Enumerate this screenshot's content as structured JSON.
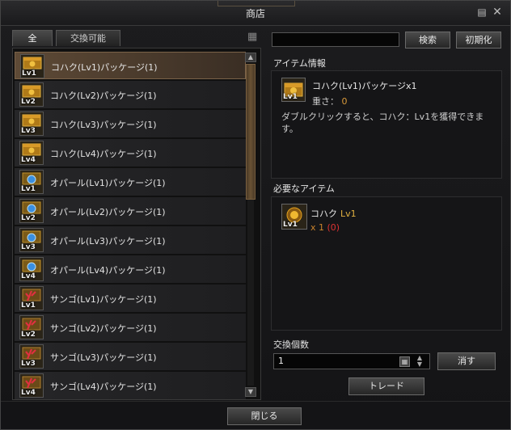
{
  "window": {
    "title": "商店",
    "help_icon": "help-menu-icon",
    "close_icon": "close-icon"
  },
  "tabs": [
    {
      "label": "全",
      "active": true
    },
    {
      "label": "交換可能",
      "active": false
    }
  ],
  "items": [
    {
      "name": "コハク(Lv1)パッケージ(1)",
      "level": "Lv1",
      "type": "amber",
      "selected": true
    },
    {
      "name": "コハク(Lv2)パッケージ(1)",
      "level": "Lv2",
      "type": "amber"
    },
    {
      "name": "コハク(Lv3)パッケージ(1)",
      "level": "Lv3",
      "type": "amber"
    },
    {
      "name": "コハク(Lv4)パッケージ(1)",
      "level": "Lv4",
      "type": "amber"
    },
    {
      "name": "オパール(Lv1)パッケージ(1)",
      "level": "Lv1",
      "type": "opal"
    },
    {
      "name": "オパール(Lv2)パッケージ(1)",
      "level": "Lv2",
      "type": "opal"
    },
    {
      "name": "オパール(Lv3)パッケージ(1)",
      "level": "Lv3",
      "type": "opal"
    },
    {
      "name": "オパール(Lv4)パッケージ(1)",
      "level": "Lv4",
      "type": "opal"
    },
    {
      "name": "サンゴ(Lv1)パッケージ(1)",
      "level": "Lv1",
      "type": "coral"
    },
    {
      "name": "サンゴ(Lv2)パッケージ(1)",
      "level": "Lv2",
      "type": "coral"
    },
    {
      "name": "サンゴ(Lv3)パッケージ(1)",
      "level": "Lv3",
      "type": "coral"
    },
    {
      "name": "サンゴ(Lv4)パッケージ(1)",
      "level": "Lv4",
      "type": "coral"
    }
  ],
  "search": {
    "value": "",
    "button": "検索",
    "reset_button": "初期化"
  },
  "info": {
    "heading": "アイテム情報",
    "name": "コハク(Lv1)パッケージx1",
    "weight_label": "重さ：",
    "weight_value": "0",
    "description": "ダブルクリックすると、コハク：Lv1を獲得できます。",
    "icon_level": "Lv1"
  },
  "required": {
    "heading": "必要なアイテム",
    "name": "コハク",
    "level": "Lv1",
    "qty_text": "x 1",
    "owned_text": "(0)",
    "icon_level": "Lv1"
  },
  "exchange": {
    "label": "交換個数",
    "quantity": "1",
    "erase_button": "消す",
    "trade_button": "トレード"
  },
  "footer": {
    "close_button": "閉じる"
  },
  "colors": {
    "selected_row": "#5e4a36",
    "amber": "#e0a020",
    "opal": "#3a8fe0",
    "coral": "#d0303a"
  }
}
